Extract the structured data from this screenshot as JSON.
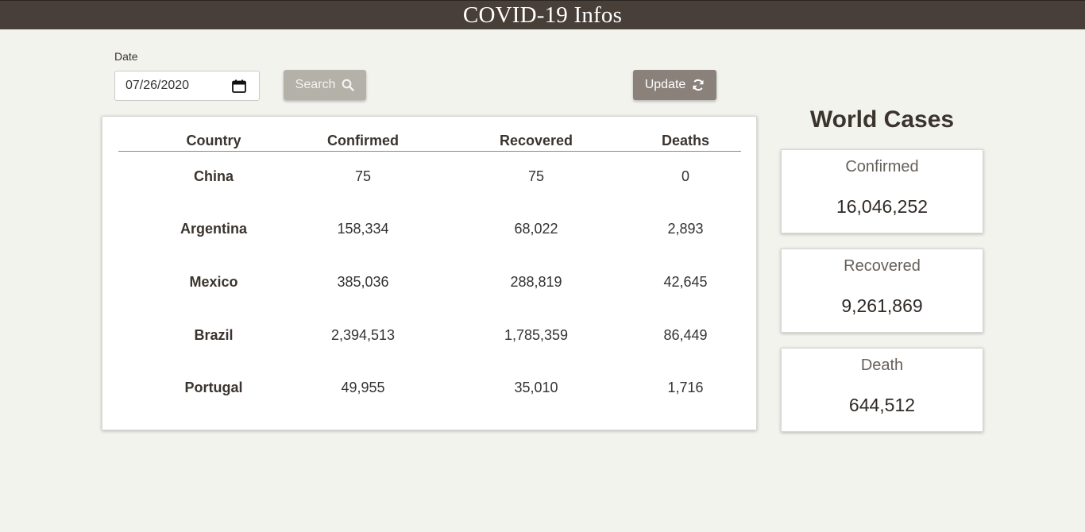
{
  "header": {
    "title": "COVID-19 Infos"
  },
  "filters": {
    "date_label": "Date",
    "date_value": "07/26/2020",
    "search_label": "Search",
    "update_label": "Update"
  },
  "table": {
    "headers": {
      "country": "Country",
      "confirmed": "Confirmed",
      "recovered": "Recovered",
      "deaths": "Deaths"
    },
    "rows": [
      {
        "country": "China",
        "confirmed": "75",
        "recovered": "75",
        "deaths": "0"
      },
      {
        "country": "Argentina",
        "confirmed": "158,334",
        "recovered": "68,022",
        "deaths": "2,893"
      },
      {
        "country": "Mexico",
        "confirmed": "385,036",
        "recovered": "288,819",
        "deaths": "42,645"
      },
      {
        "country": "Brazil",
        "confirmed": "2,394,513",
        "recovered": "1,785,359",
        "deaths": "86,449"
      },
      {
        "country": "Portugal",
        "confirmed": "49,955",
        "recovered": "35,010",
        "deaths": "1,716"
      }
    ]
  },
  "world": {
    "title": "World Cases",
    "confirmed": {
      "label": "Confirmed",
      "value": "16,046,252"
    },
    "recovered": {
      "label": "Recovered",
      "value": "9,261,869"
    },
    "death": {
      "label": "Death",
      "value": "644,512"
    }
  },
  "icons": {
    "search": "search-icon",
    "update": "refresh-icon",
    "calendar": "calendar-icon"
  },
  "colors": {
    "header_bg": "#483f39",
    "page_bg": "#f3f3ee",
    "search_button": "#b4b1a8",
    "update_button": "#8a817b",
    "text_dark": "#3b342e"
  }
}
